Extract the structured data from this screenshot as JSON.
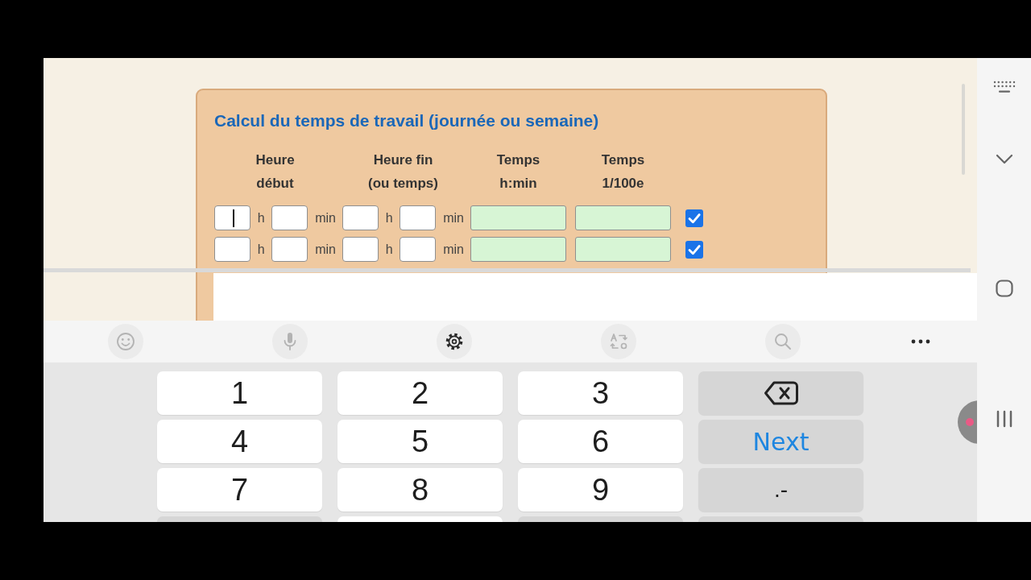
{
  "web_page": {
    "title": "Calcul du temps de travail (journée ou semaine)",
    "columns": [
      {
        "lines": [
          "Heure",
          "début"
        ]
      },
      {
        "lines": [
          "Heure fin",
          "(ou temps)"
        ]
      },
      {
        "lines": [
          "Temps",
          "h:min"
        ]
      },
      {
        "lines": [
          "Temps",
          "1/100e"
        ]
      }
    ],
    "rows": [
      {
        "fields": [
          {
            "kind": "entry",
            "unit": "h",
            "focused": true
          },
          {
            "kind": "entry",
            "unit": "min",
            "focused": false
          },
          {
            "kind": "entry",
            "unit": "h",
            "focused": false
          },
          {
            "kind": "entry",
            "unit": "min",
            "focused": false
          },
          {
            "kind": "result",
            "focused": false
          },
          {
            "kind": "result",
            "focused": false
          }
        ],
        "checked": true
      },
      {
        "fields": [
          {
            "kind": "entry",
            "unit": "h",
            "focused": false
          },
          {
            "kind": "entry",
            "unit": "min",
            "focused": false
          },
          {
            "kind": "entry",
            "unit": "h",
            "focused": false
          },
          {
            "kind": "entry",
            "unit": "min",
            "focused": false
          },
          {
            "kind": "result",
            "focused": false
          },
          {
            "kind": "result",
            "focused": false
          }
        ],
        "checked": true
      }
    ]
  },
  "keyboard": {
    "toolbar": [
      {
        "kind": "emoji",
        "disabled": true
      },
      {
        "kind": "voice",
        "disabled": true
      },
      {
        "kind": "settings",
        "disabled": false
      },
      {
        "kind": "translate",
        "disabled": true
      },
      {
        "kind": "search",
        "disabled": true
      },
      {
        "kind": "more",
        "disabled": false
      }
    ],
    "keys": [
      {
        "kind": "digit",
        "label": "1"
      },
      {
        "kind": "digit",
        "label": "2"
      },
      {
        "kind": "digit",
        "label": "3"
      },
      {
        "kind": "backspace"
      },
      {
        "kind": "digit",
        "label": "4"
      },
      {
        "kind": "digit",
        "label": "5"
      },
      {
        "kind": "digit",
        "label": "6"
      },
      {
        "kind": "action",
        "label": "Next"
      },
      {
        "kind": "digit",
        "label": "7"
      },
      {
        "kind": "digit",
        "label": "8"
      },
      {
        "kind": "digit",
        "label": "9"
      },
      {
        "kind": "symbol",
        "label": ".-"
      },
      {
        "kind": "symbol"
      },
      {
        "kind": "digit"
      },
      {
        "kind": "symbol"
      },
      {
        "kind": "symbol"
      }
    ]
  }
}
